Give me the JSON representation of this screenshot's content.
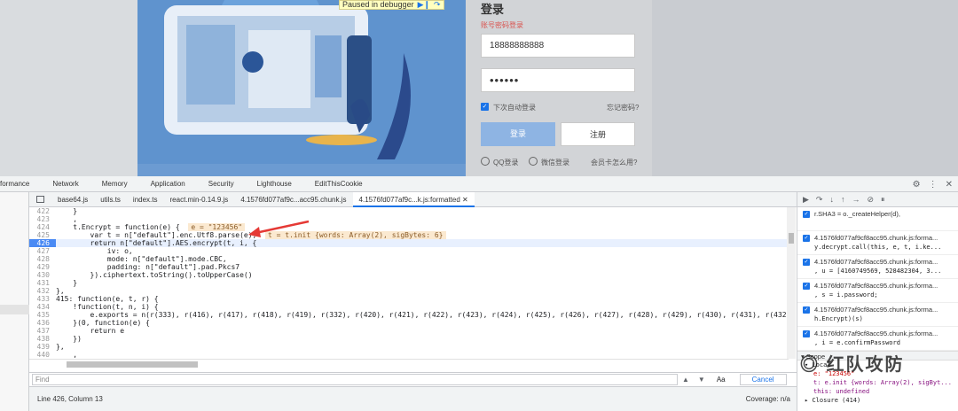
{
  "page": {
    "debugger_banner": "Paused in debugger",
    "login": {
      "title": "登录",
      "subtitle": "账号密码登录",
      "username_value": "18888888888",
      "password_value": "••••••",
      "remember_label": "下次自动登录",
      "forgot_label": "忘记密码?",
      "login_button": "登录",
      "register_button": "注册",
      "qq_label": "QQ登录",
      "wechat_label": "微信登录",
      "member_label": "会员卡怎么用?"
    }
  },
  "devtools": {
    "panel_tabs": [
      "formance",
      "Network",
      "Memory",
      "Application",
      "Security",
      "Lighthouse",
      "EditThisCookie"
    ],
    "file_tabs": [
      "base64.js",
      "utils.ts",
      "index.ts",
      "react.min-0.14.9.js",
      "4.1576fd077af9c...acc95.chunk.js",
      "4.1576fd077af9c...k.js:formatted"
    ],
    "code_lines": [
      {
        "n": "422",
        "t": "    }"
      },
      {
        "n": "423",
        "t": "    ,"
      },
      {
        "n": "424",
        "pre": "    t.Encrypt = function(e) {  ",
        "inline": "e = \"123456\""
      },
      {
        "n": "425",
        "pre": "        var t = n[\"default\"].enc.Utf8.parse(e);  ",
        "inline": "t = t.init {words: Array(2), sigBytes: 6}"
      },
      {
        "n": "426",
        "t": "        return n[\"default\"].AES.encrypt(t, i, {",
        "active": true
      },
      {
        "n": "427",
        "t": "            iv: o,"
      },
      {
        "n": "428",
        "t": "            mode: n[\"default\"].mode.CBC,"
      },
      {
        "n": "429",
        "t": "            padding: n[\"default\"].pad.Pkcs7"
      },
      {
        "n": "430",
        "t": "        }).ciphertext.toString().toUpperCase()"
      },
      {
        "n": "431",
        "t": "    }"
      },
      {
        "n": "432",
        "t": "},"
      },
      {
        "n": "433",
        "t": "415: function(e, t, r) {"
      },
      {
        "n": "434",
        "t": "    !function(t, n, i) {"
      },
      {
        "n": "435",
        "t": "        e.exports = n(r(333), r(416), r(417), r(418), r(419), r(332), r(420), r(421), r(422), r(423), r(424), r(425), r(426), r(427), r(428), r(429), r(430), r(431), r(432), r(433), r"
      },
      {
        "n": "436",
        "t": "    }(0, function(e) {"
      },
      {
        "n": "437",
        "t": "        return e"
      },
      {
        "n": "438",
        "t": "    })"
      },
      {
        "n": "439",
        "t": "},"
      },
      {
        "n": "440",
        "t": "    ,"
      }
    ],
    "find": {
      "placeholder": "Find",
      "match_case": "Aa",
      ".star": ".*",
      "cancel": "Cancel"
    },
    "status": {
      "position": "Line 426, Column 13",
      "coverage": "Coverage: n/a"
    },
    "breakpoints": [
      {
        "file": "r.SHA3 = o._createHelper(d),",
        "code": ""
      },
      {
        "file": "4.1576fd077af9cf8acc95.chunk.js:forma...",
        "code": "y.decrypt.call(this, e, t, i.ke..."
      },
      {
        "file": "4.1576fd077af9cf8acc95.chunk.js:forma...",
        "code": ", u = [4160749569, 528482304, 3..."
      },
      {
        "file": "4.1576fd077af9cf8acc95.chunk.js:forma...",
        "code": ", s = i.password;"
      },
      {
        "file": "4.1576fd077af9cf8acc95.chunk.js:forma...",
        "code": "h.Encrypt)(s)"
      },
      {
        "file": "4.1576fd077af9cf8acc95.chunk.js:forma...",
        "code": ", i = e.confirmPassword"
      }
    ],
    "scope": {
      "header": "Scope",
      "local": "Local",
      "e_val": "e: \"123456\"",
      "t_val": "t: e.init {words: Array(2), sigByt...",
      "this_val": "this: undefined",
      "closure": "Closure (414)"
    },
    "watermark": "红队攻防"
  }
}
